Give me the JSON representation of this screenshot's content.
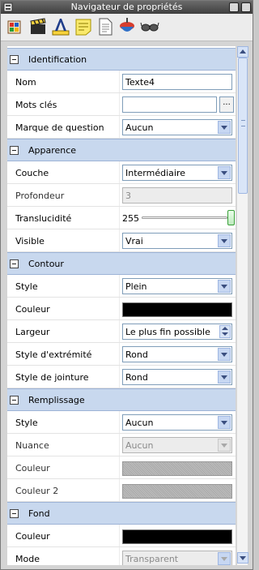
{
  "window": {
    "title": "Navigateur de propriétés"
  },
  "toolbar": {
    "icons": [
      "paint-bucket-icon",
      "film-clapper-icon",
      "text-color-icon",
      "sticky-note-icon",
      "document-icon",
      "spinning-top-icon",
      "glasses-icon"
    ]
  },
  "sections": {
    "identification": {
      "title": "Identification",
      "name_label": "Nom",
      "name_value": "Texte4",
      "keywords_label": "Mots clés",
      "keywords_value": "",
      "keywords_button": "...",
      "question_label": "Marque de question",
      "question_value": "Aucun"
    },
    "appearance": {
      "title": "Apparence",
      "layer_label": "Couche",
      "layer_value": "Intermédiaire",
      "depth_label": "Profondeur",
      "depth_value": "3",
      "translucency_label": "Translucidité",
      "translucency_value": "255",
      "visible_label": "Visible",
      "visible_value": "Vrai"
    },
    "contour": {
      "title": "Contour",
      "style_label": "Style",
      "style_value": "Plein",
      "color_label": "Couleur",
      "color_value": "#000000",
      "width_label": "Largeur",
      "width_value": "Le plus fin possible",
      "cap_label": "Style d'extrémité",
      "cap_value": "Rond",
      "join_label": "Style de jointure",
      "join_value": "Rond"
    },
    "fill": {
      "title": "Remplissage",
      "style_label": "Style",
      "style_value": "Aucun",
      "shade_label": "Nuance",
      "shade_value": "Aucun",
      "color_label": "Couleur",
      "color2_label": "Couleur 2"
    },
    "background": {
      "title": "Fond",
      "color_label": "Couleur",
      "color_value": "#000000",
      "mode_label": "Mode",
      "mode_value": "Transparent"
    }
  },
  "colors": {
    "section_header": "#c8d8ee",
    "accent": "#7f9db9"
  }
}
